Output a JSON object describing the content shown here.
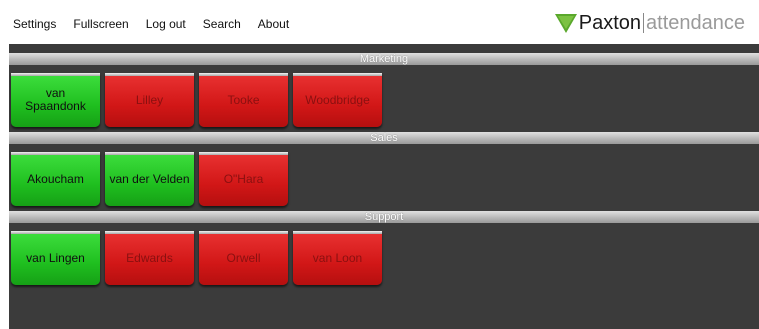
{
  "menu": {
    "items": [
      {
        "label": "Settings"
      },
      {
        "label": "Fullscreen"
      },
      {
        "label": "Log out"
      },
      {
        "label": "Search"
      },
      {
        "label": "About"
      }
    ]
  },
  "logo": {
    "brand": "Paxton",
    "product": "attendance",
    "icon": "green-triangle-logo"
  },
  "colors": {
    "present": "#22c422",
    "absent": "#d41a1a",
    "board_background": "#3b3b3b"
  },
  "groups": [
    {
      "name": "Marketing",
      "people": [
        {
          "name": "van Spaandonk",
          "status": "in"
        },
        {
          "name": "Lilley",
          "status": "out"
        },
        {
          "name": "Tooke",
          "status": "out"
        },
        {
          "name": "Woodbridge",
          "status": "out"
        }
      ]
    },
    {
      "name": "Sales",
      "people": [
        {
          "name": "Akoucham",
          "status": "in"
        },
        {
          "name": "van der Velden",
          "status": "in"
        },
        {
          "name": "O\"Hara",
          "status": "out"
        }
      ]
    },
    {
      "name": "Support",
      "people": [
        {
          "name": "van Lingen",
          "status": "in"
        },
        {
          "name": "Edwards",
          "status": "out"
        },
        {
          "name": "Orwell",
          "status": "out"
        },
        {
          "name": "van Loon",
          "status": "out"
        }
      ]
    }
  ]
}
